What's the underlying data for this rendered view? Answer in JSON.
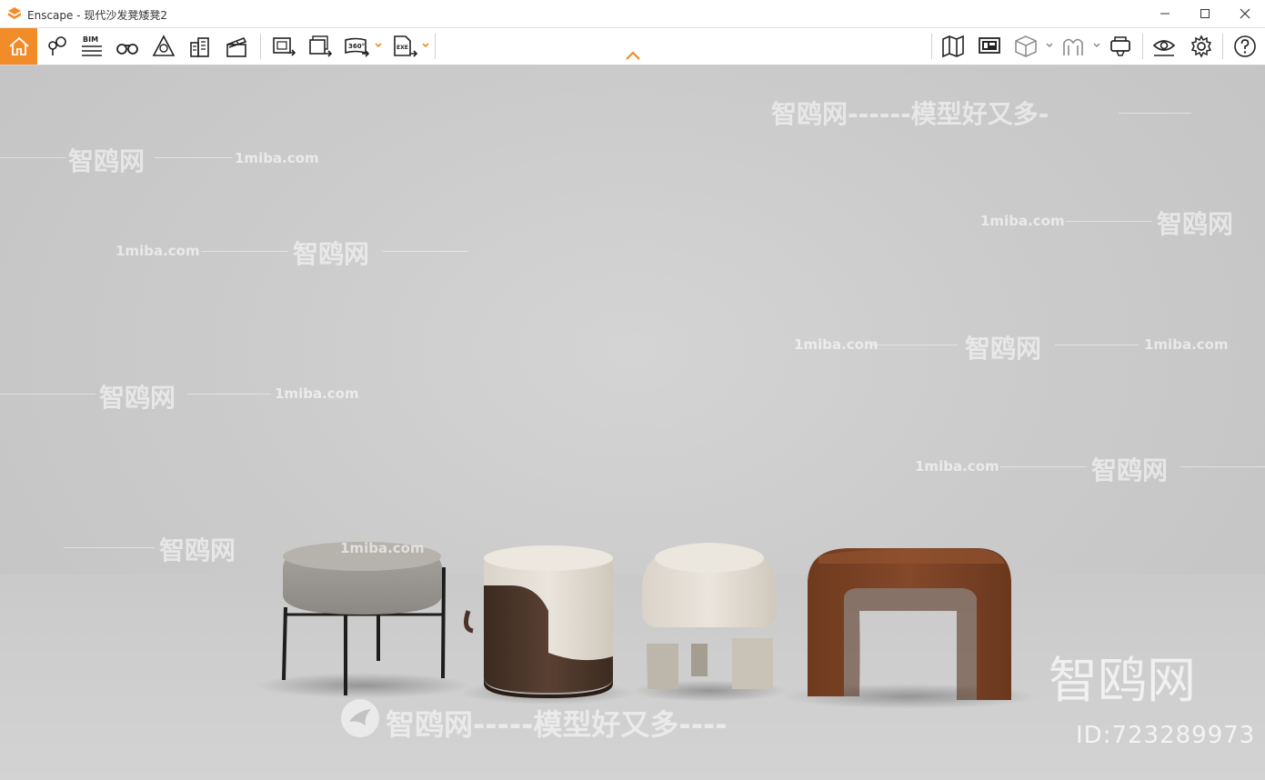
{
  "window": {
    "app_name": "Enscape",
    "title": "Enscape - 现代沙发凳矮凳2",
    "minimize_icon": "minimize-icon",
    "maximize_icon": "maximize-icon",
    "close_icon": "close-icon"
  },
  "toolbar": {
    "accent_color": "#f28c28",
    "bim_label": "BIM",
    "panorama_label": "360°",
    "exe_label": "EXE",
    "left_tools": [
      "home-icon",
      "location-pin-icon",
      "bim-icon",
      "binoculars-icon",
      "navigation-icon",
      "buildings-icon",
      "clapper-icon",
      "screenshot-icon",
      "batch-render-icon",
      "panorama-icon",
      "exe-export-icon"
    ],
    "right_tools": [
      "map-icon",
      "presentation-icon",
      "cube-icon",
      "material-icon",
      "vr-headset-icon",
      "view-eye-icon",
      "settings-gear-icon",
      "help-icon"
    ]
  },
  "watermarks": {
    "site": "1miba.com",
    "brand": "智鸥网",
    "slogan": "智鸥网-----模型好又多----",
    "slogan_top": "智鸥网------模型好又多-",
    "big_brand": "智鸥网",
    "id_text": "ID:723289973"
  },
  "scene": {
    "objects": [
      "round-stool-metal-legs",
      "drum-pouf-with-handle",
      "mushroom-stool",
      "arched-bench-brown"
    ]
  }
}
